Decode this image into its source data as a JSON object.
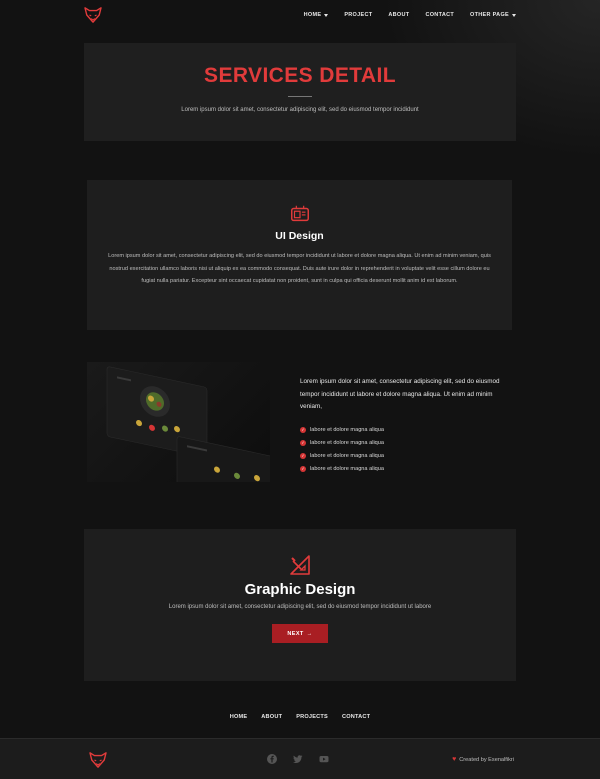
{
  "colors": {
    "accent": "#e13b3b",
    "button": "#a91e23",
    "background": "#121212",
    "card": "#1e1e1e"
  },
  "nav": {
    "logo_icon": "fox-logo-icon",
    "items": [
      {
        "label": "HOME",
        "has_dropdown": true
      },
      {
        "label": "PROJECT",
        "has_dropdown": false
      },
      {
        "label": "ABOUT",
        "has_dropdown": false
      },
      {
        "label": "CONTACT",
        "has_dropdown": false
      },
      {
        "label": "OTHER PAGE",
        "has_dropdown": true
      }
    ]
  },
  "hero": {
    "title": "SERVICES DETAIL",
    "subtitle": "Lorem ipsum dolor sit amet, consectetur adipiscing elit, sed do eiusmod tempor incididunt"
  },
  "ui_design": {
    "icon": "ui-design-icon",
    "title": "UI Design",
    "description": "Lorem ipsum dolor sit amet, consectetur adipiscing elit, sed do eiusmod tempor incididunt ut labore et dolore magna aliqua. Ut enim ad minim veniam, quis nostrud exercitation ullamco laboris nisi ut aliquip ex ea commodo consequat. Duis aute irure dolor in reprehenderit in voluptate velit esse cillum dolore eu fugiat nulla pariatur. Excepteur sint occaecat cupidatat non proident, sunt in culpa qui officia deserunt mollit anim id est laborum."
  },
  "feature": {
    "text": "Lorem ipsum dolor sit amet, consectetur adipiscing elit, sed do eiusmod tempor incididunt ut labore et dolore magna aliqua. Ut enim ad minim veniam,",
    "checklist": [
      "labore et dolore magna aliqua",
      "labore et dolore magna aliqua",
      "labore et dolore magna aliqua",
      "labore et dolore magna aliqua"
    ]
  },
  "graphic_design": {
    "icon": "graphic-design-icon",
    "title": "Graphic Design",
    "subtitle": "Lorem ipsum dolor sit amet, consectetur adipiscing elit, sed do eiusmod tempor incididunt ut labore",
    "button_label": "NEXT",
    "button_arrow": "→"
  },
  "footer": {
    "links": [
      "HOME",
      "ABOUT",
      "PROJECTS",
      "CONTACT"
    ],
    "socials": [
      "facebook-icon",
      "twitter-icon",
      "youtube-icon"
    ],
    "credit": "Created by Esenalfikri"
  }
}
